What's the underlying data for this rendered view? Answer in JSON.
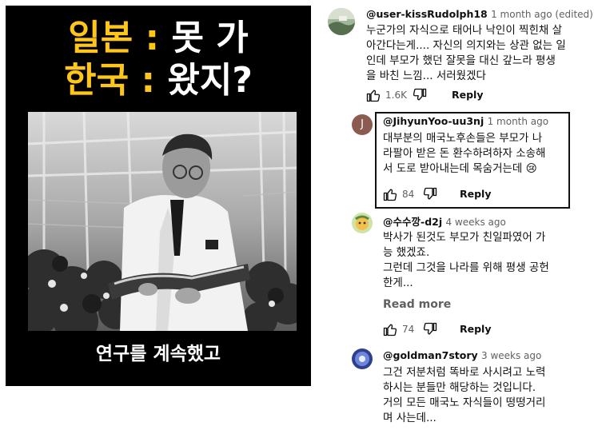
{
  "thumbnail": {
    "line1_left": "일본",
    "line1_sep": " : ",
    "line1_right": "못 가",
    "line2_left": "한국",
    "line2_sep": " : ",
    "line2_right": "왔지?",
    "caption": "연구를 계속했고",
    "colors": {
      "accent": "#ffc61a",
      "background": "#000000"
    }
  },
  "comments": [
    {
      "author": "@user-kissRudolph18",
      "time": "1 month ago (edited)",
      "lines": [
        "누군가의 자식으로 태어나 낙인이 찍힌채 살",
        "아간다는게.... 자신의 의지와는 상관 없는 일",
        "인데 부모가 했던 잘못을 대신 갚느라 평생",
        "을 바친 느낌... 서러웠겠다"
      ],
      "likes": "1.6K",
      "reply_label": "Reply",
      "avatar_icon": "landscape-avatar-icon"
    },
    {
      "author": "@JihyunYoo-uu3nj",
      "time": "1 month ago",
      "avatar_letter": "J",
      "lines": [
        "대부분의 매국노후손들은 부모가 나",
        "라팔아 받은 돈 환수하려하자 소송해",
        "서 도로 받아내는데 목숨거는데 😢"
      ],
      "likes": "84",
      "reply_label": "Reply",
      "highlighted": true
    },
    {
      "author": "@수수깡-d2j",
      "time": "4 weeks ago",
      "lines": [
        "박사가 된것도 부모가 친일파였어 가",
        "능 했겠죠.",
        "그런데 그것을 나라를 위해 평생 공헌",
        "한게..."
      ],
      "read_more": "Read more",
      "likes": "74",
      "reply_label": "Reply",
      "avatar_icon": "character-avatar-icon"
    },
    {
      "author": "@goldman7story",
      "time": "3 weeks ago",
      "lines": [
        "그건 저분처럼 똑바로 사시려고 노력",
        "하시는 분들만 해당하는 것입니다.",
        "거의 모든 매국노 자식들이 떵떵거리",
        "며 사는데..."
      ],
      "avatar_icon": "blue-avatar-icon"
    }
  ]
}
